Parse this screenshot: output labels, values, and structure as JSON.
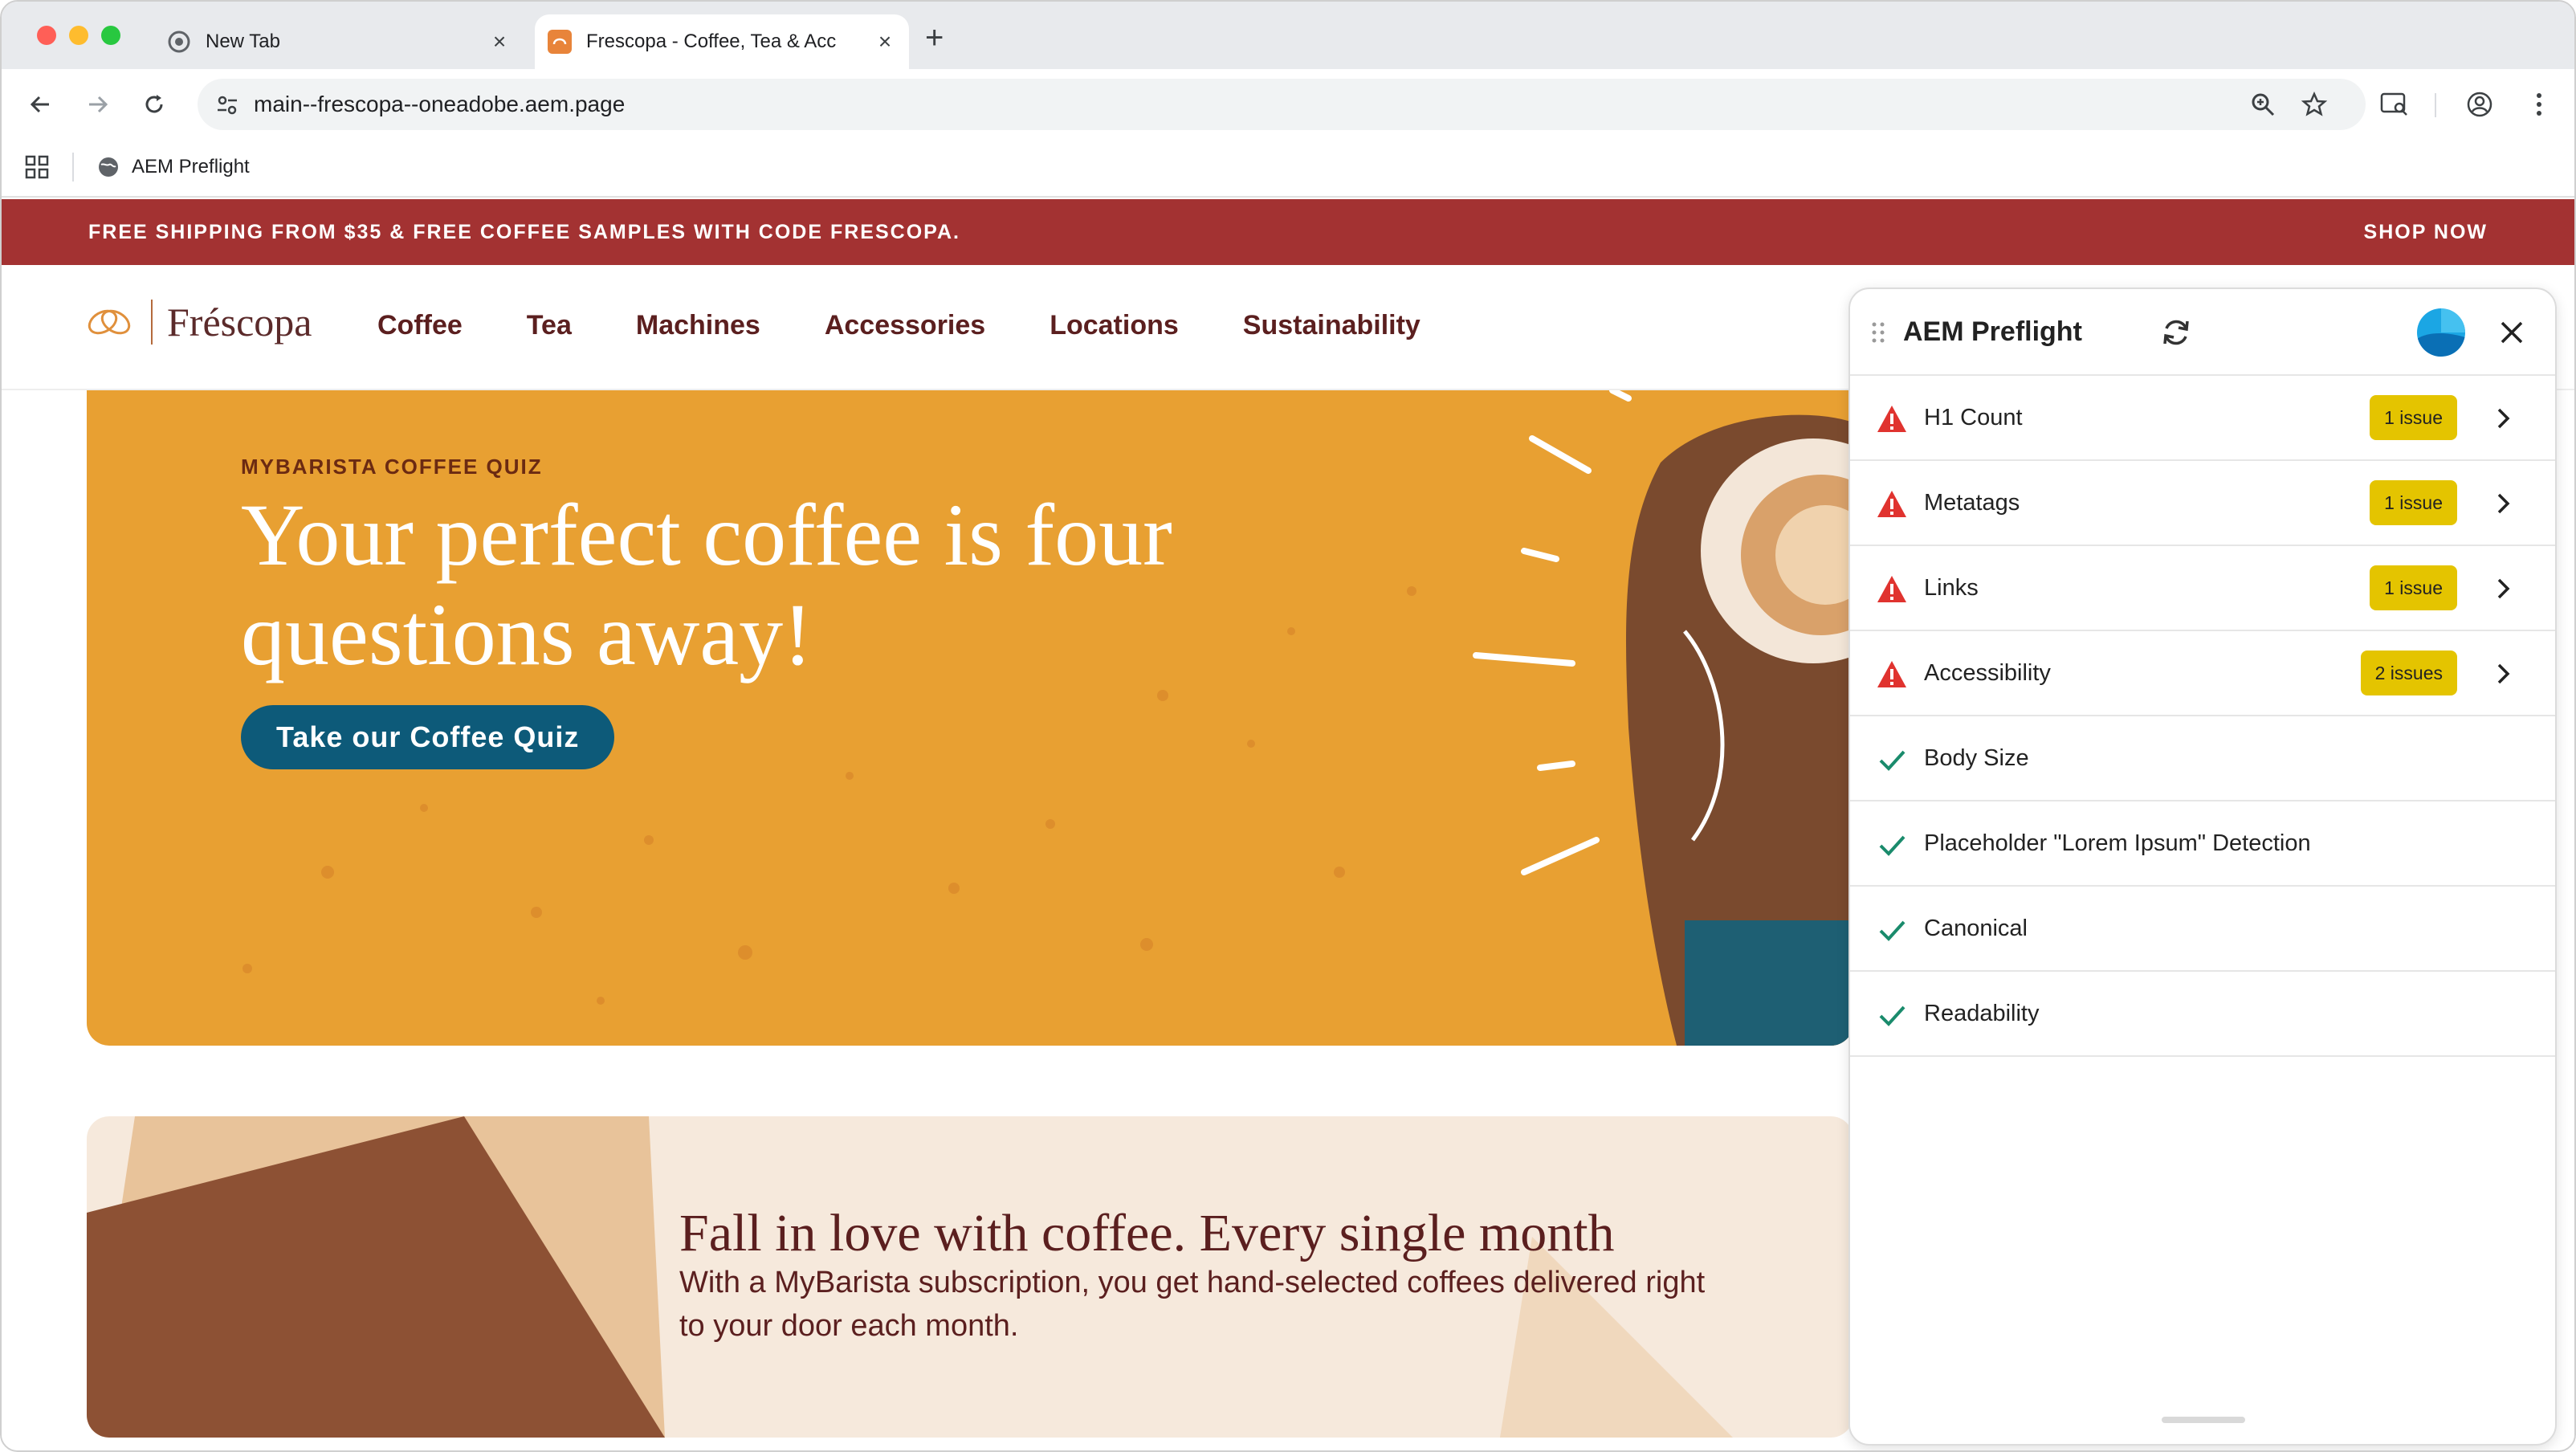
{
  "browser": {
    "tabs": [
      {
        "title": "New Tab",
        "active": false
      },
      {
        "title": "Frescopa - Coffee, Tea & Acc",
        "active": true
      }
    ],
    "url": "main--frescopa--oneadobe.aem.page",
    "bookmarks": [
      {
        "label": "AEM Preflight"
      }
    ]
  },
  "site": {
    "promo": {
      "message": "FREE SHIPPING FROM $35 & FREE COFFEE SAMPLES WITH CODE FRESCOPA.",
      "cta": "SHOP NOW"
    },
    "logo_text": "Fréscopa",
    "nav": [
      "Coffee",
      "Tea",
      "Machines",
      "Accessories",
      "Locations",
      "Sustainability"
    ],
    "hero": {
      "eyebrow": "MYBARISTA COFFEE QUIZ",
      "title": "Your perfect coffee is four questions away!",
      "cta": "Take our Coffee Quiz"
    },
    "subscription": {
      "title": "Fall in love with coffee. Every single month",
      "body": "With a MyBarista subscription, you get hand-selected coffees delivered right to your door each month."
    }
  },
  "panel": {
    "title": "AEM Preflight",
    "checks": [
      {
        "label": "H1 Count",
        "status": "warning",
        "badge": "1 issue"
      },
      {
        "label": "Metatags",
        "status": "warning",
        "badge": "1 issue"
      },
      {
        "label": "Links",
        "status": "warning",
        "badge": "1 issue"
      },
      {
        "label": "Accessibility",
        "status": "warning",
        "badge": "2 issues"
      },
      {
        "label": "Body Size",
        "status": "pass",
        "badge": ""
      },
      {
        "label": "Placeholder \"Lorem Ipsum\" Detection",
        "status": "pass",
        "badge": ""
      },
      {
        "label": "Canonical",
        "status": "pass",
        "badge": ""
      },
      {
        "label": "Readability",
        "status": "pass",
        "badge": ""
      }
    ]
  },
  "colors": {
    "promo_bg": "#a33232",
    "hero_bg": "#e8a032",
    "cta_bg": "#0d5a79",
    "warning_icon": "#e0332f",
    "pass_icon": "#1a8b6c",
    "badge_bg": "#e4c400"
  }
}
